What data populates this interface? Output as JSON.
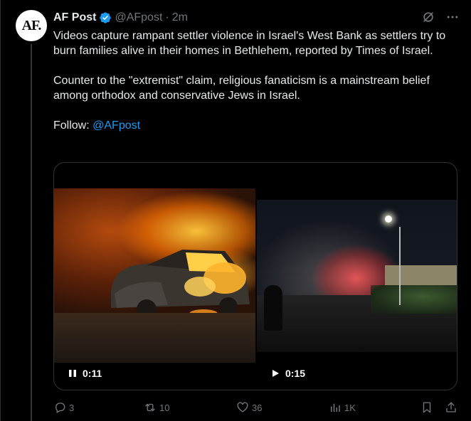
{
  "tweet": {
    "author_logo": "AF.",
    "author_name": "AF Post",
    "handle": "@AFpost",
    "separator": "·",
    "time": "2m",
    "paragraph1": "Videos capture rampant settler violence in Israel's West Bank as settlers try to burn families alive in their homes in Bethlehem, reported by Times of Israel.",
    "paragraph2": "Counter to the \"extremist\" claim, religious fanaticism is a mainstream belief among orthodox and conservative Jews in Israel.",
    "follow_label": "Follow: ",
    "follow_mention": "@AFpost"
  },
  "media": {
    "video1": {
      "state_icon": "pause-icon",
      "duration": "0:11"
    },
    "video2": {
      "state_icon": "play-icon",
      "duration": "0:15"
    }
  },
  "actions": {
    "replies": "3",
    "reposts": "10",
    "likes": "36",
    "views": "1K"
  },
  "colors": {
    "background": "#000000",
    "text": "#e7e9ea",
    "muted": "#71767b",
    "accent": "#1d9bf0",
    "border": "#2f3336"
  },
  "icons": [
    "verified-badge-icon",
    "grok-icon",
    "more-icon",
    "reply-icon",
    "repost-icon",
    "like-icon",
    "views-icon",
    "bookmark-icon",
    "share-icon"
  ]
}
